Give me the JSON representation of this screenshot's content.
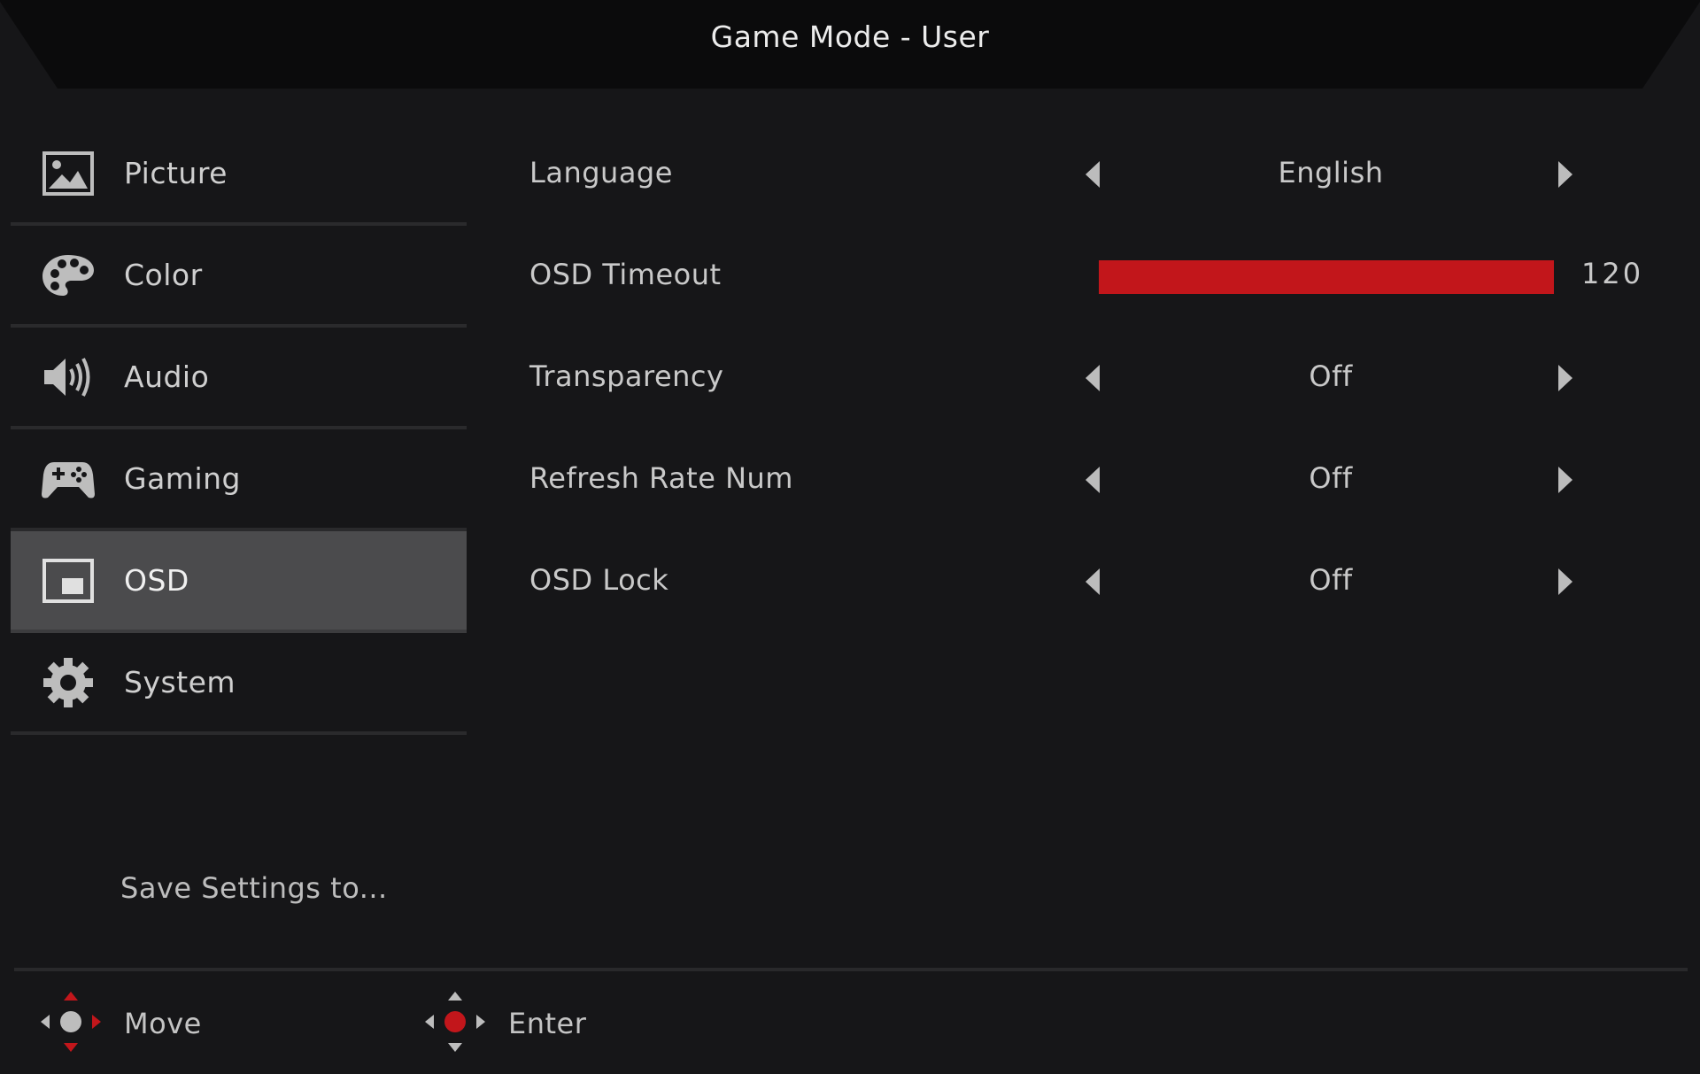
{
  "title": "Game Mode - User",
  "nav": {
    "items": [
      {
        "label": "Picture",
        "icon": "picture-icon"
      },
      {
        "label": "Color",
        "icon": "palette-icon"
      },
      {
        "label": "Audio",
        "icon": "speaker-icon"
      },
      {
        "label": "Gaming",
        "icon": "gamepad-icon"
      },
      {
        "label": "OSD",
        "icon": "osd-icon",
        "active": true
      },
      {
        "label": "System",
        "icon": "gear-icon"
      }
    ],
    "save_label": "Save Settings to..."
  },
  "settings": {
    "language": {
      "label": "Language",
      "value": "English"
    },
    "osd_timeout": {
      "label": "OSD Timeout",
      "value": "120",
      "fill_fraction": 1.0
    },
    "transparency": {
      "label": "Transparency",
      "value": "Off"
    },
    "refresh_rate_num": {
      "label": "Refresh Rate Num",
      "value": "Off"
    },
    "osd_lock": {
      "label": "OSD Lock",
      "value": "Off"
    }
  },
  "footer": {
    "move_label": "Move",
    "enter_label": "Enter"
  },
  "colors": {
    "accent": "#c2161b",
    "background": "#161618",
    "active_item": "#4b4b4d",
    "text": "#c9c9c9"
  }
}
